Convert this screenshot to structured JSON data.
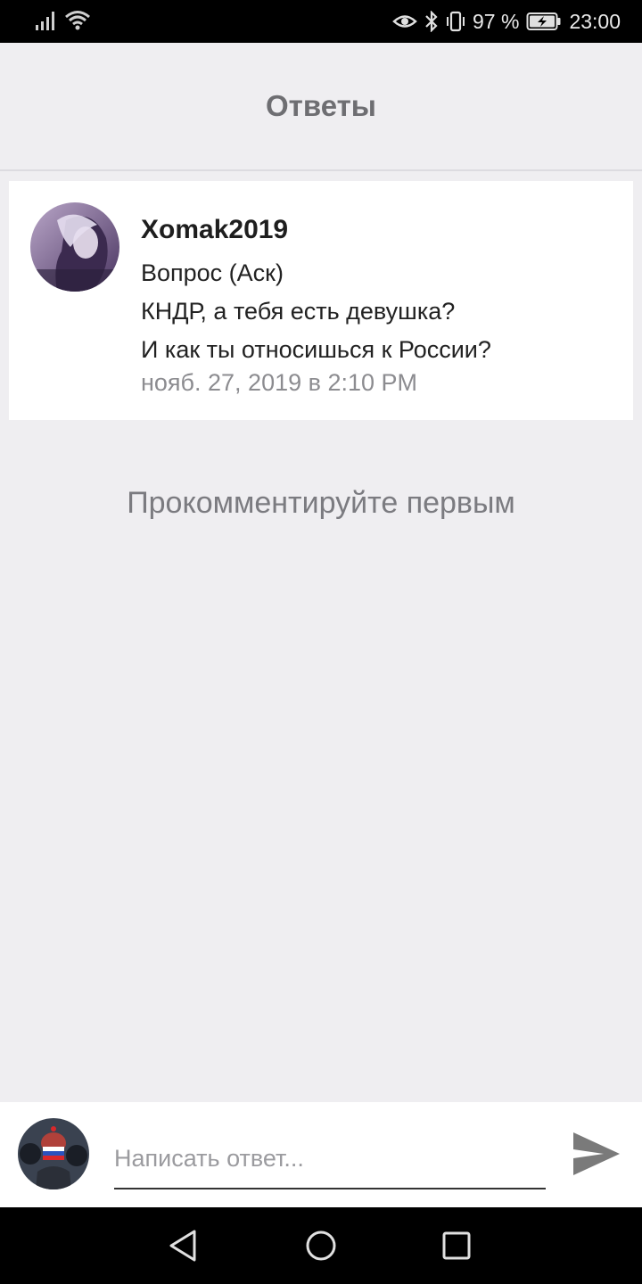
{
  "status_bar": {
    "battery_percent": "97 %",
    "time": "23:00",
    "icons": [
      "signal-icon",
      "wifi-icon",
      "eye-comfort-icon",
      "bluetooth-icon",
      "vibrate-icon",
      "battery-charging-icon"
    ]
  },
  "header": {
    "title": "Ответы"
  },
  "question": {
    "author": "Xomak2019",
    "type": "Вопрос (Аск)",
    "lines": [
      "КНДР, а тебя есть девушка?",
      "И как ты относишься к России?"
    ],
    "date": "нояб. 27, 2019 в 2:10 PM"
  },
  "comments": {
    "empty_text": "Прокомментируйте первым"
  },
  "composer": {
    "placeholder": "Написать ответ...",
    "value": ""
  },
  "nav": {
    "icons": [
      "back-icon",
      "home-icon",
      "recents-icon"
    ]
  },
  "colors": {
    "background": "#efeef1",
    "card": "#ffffff",
    "status_bar": "#000000",
    "send_icon": "#7a7a7a"
  }
}
